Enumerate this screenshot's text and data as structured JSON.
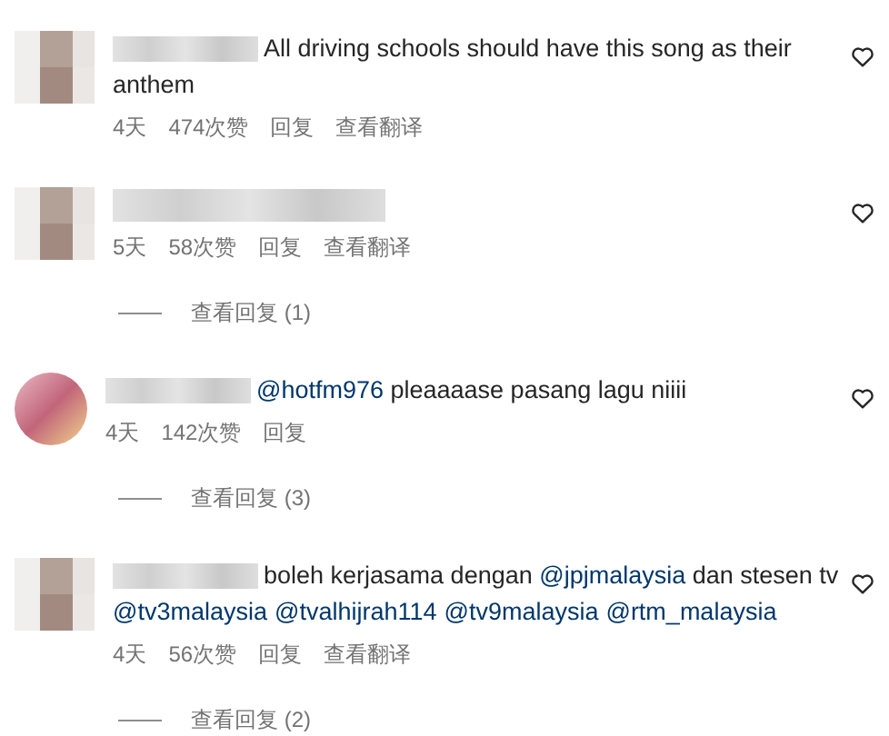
{
  "comments": [
    {
      "kind": "square",
      "lines": [
        [
          {
            "kind": "plain",
            "text": "All driving schools should have this song as their"
          }
        ],
        [
          {
            "kind": "plain",
            "text": "anthem"
          }
        ]
      ],
      "time": "4天",
      "likes": "474次赞",
      "reply": "回复",
      "translate": "查看翻译"
    },
    {
      "kind": "square",
      "time": "5天",
      "likes": "58次赞",
      "reply": "回复",
      "translate": "查看翻译",
      "replies_link": "查看回复 (1)"
    },
    {
      "kind": "ring",
      "lines": [
        [
          {
            "kind": "mention",
            "text": "@hotfm976"
          },
          {
            "kind": "plain",
            "text": " pleaaaase pasang lagu niiii"
          }
        ]
      ],
      "time": "4天",
      "likes": "142次赞",
      "reply": "回复",
      "replies_link": "查看回复 (3)"
    },
    {
      "kind": "square",
      "lines": [
        [
          {
            "kind": "plain",
            "text": "boleh kerjasama dengan "
          },
          {
            "kind": "mention",
            "text": "@jpjmalaysia"
          },
          {
            "kind": "plain",
            "text": " dan stesen tv"
          }
        ],
        [
          {
            "kind": "mention",
            "text": "@tv3malaysia"
          },
          {
            "kind": "mention",
            "text": "@tvalhijrah114"
          },
          {
            "kind": "mention",
            "text": "@tv9malaysia"
          },
          {
            "kind": "mention",
            "text": "@rtm_malaysia"
          }
        ]
      ],
      "time": "4天",
      "likes": "56次赞",
      "reply": "回复",
      "translate": "查看翻译",
      "replies_link": "查看回复 (2)"
    }
  ]
}
